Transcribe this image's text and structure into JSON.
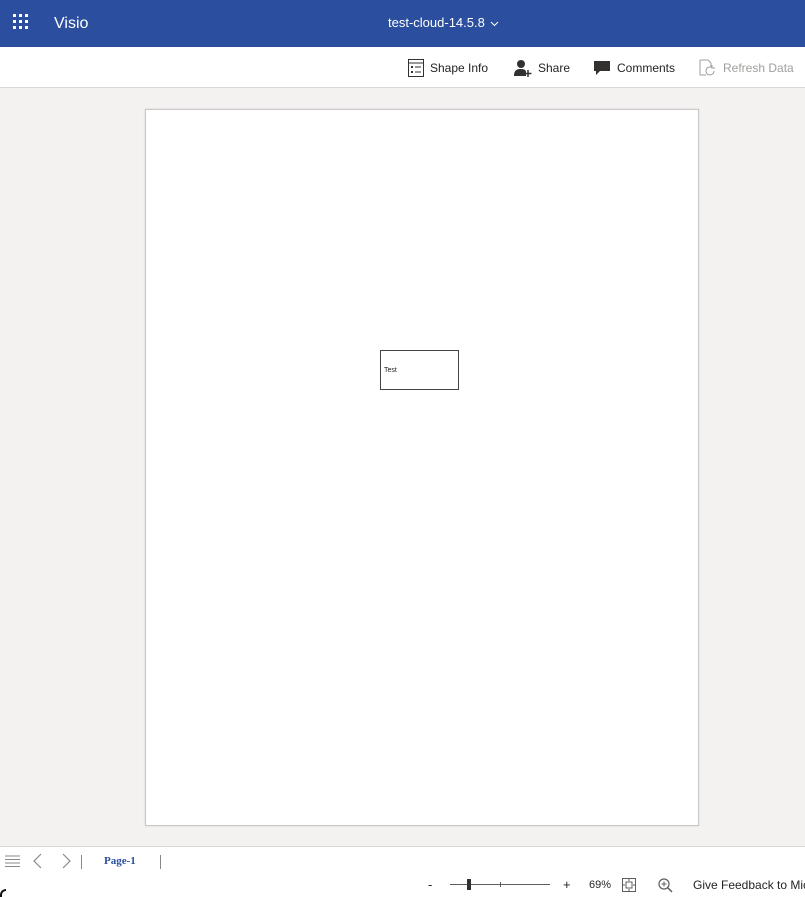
{
  "header": {
    "app_name": "Visio",
    "document_title": "test-cloud-14.5.8",
    "background_color": "#2b4f9e",
    "icons": {
      "launcher": "app-launcher-waffle-icon",
      "title_dropdown": "chevron-down-icon"
    }
  },
  "command_bar": {
    "shape_info": {
      "label": "Shape Info",
      "icon": "shape-info-icon"
    },
    "share": {
      "label": "Share",
      "icon": "add-person-icon"
    },
    "comments": {
      "label": "Comments",
      "icon": "comment-icon"
    },
    "refresh_data": {
      "label": "Refresh Data",
      "icon": "refresh-data-icon",
      "disabled": true
    }
  },
  "canvas": {
    "shapes": [
      {
        "text": "Test"
      }
    ]
  },
  "page_tabs": {
    "icons": [
      "all-pages-menu-icon",
      "previous-page-icon",
      "next-page-icon"
    ],
    "tabs": [
      {
        "label": "Page-1",
        "active": true
      }
    ]
  },
  "status_bar": {
    "zoom_out": "-",
    "zoom_in": "+",
    "zoom_level": "69%",
    "zoom_fraction": 0.19,
    "fit_icon": "fit-to-window-icon",
    "zoom_icon": "zoom-magnifier-icon",
    "feedback": "Give Feedback to Mic"
  }
}
